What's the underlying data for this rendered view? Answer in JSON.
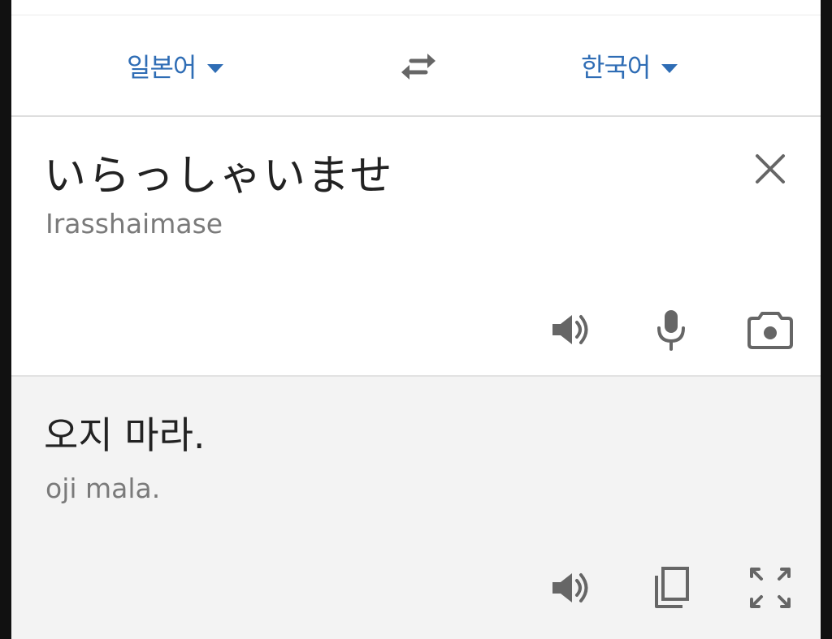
{
  "languages": {
    "source": "일본어",
    "target": "한국어"
  },
  "input": {
    "text": "いらっしゃいませ",
    "transliteration": "Irasshaimase"
  },
  "output": {
    "text": "오지 마라.",
    "transliteration": "oji mala."
  },
  "icons": {
    "source_dropdown": "caret-down-icon",
    "target_dropdown": "caret-down-icon",
    "swap": "swap-arrows-icon",
    "clear": "close-icon",
    "listen_source": "speaker-icon",
    "voice_input": "microphone-icon",
    "camera": "camera-icon",
    "listen_result": "speaker-icon",
    "copy": "copy-icon",
    "fullscreen": "fullscreen-icon"
  },
  "colors": {
    "accent": "#2f6db5",
    "text": "#222222",
    "secondary_text": "#7a7a7a",
    "icon": "#666666",
    "result_background": "#f3f3f3"
  }
}
